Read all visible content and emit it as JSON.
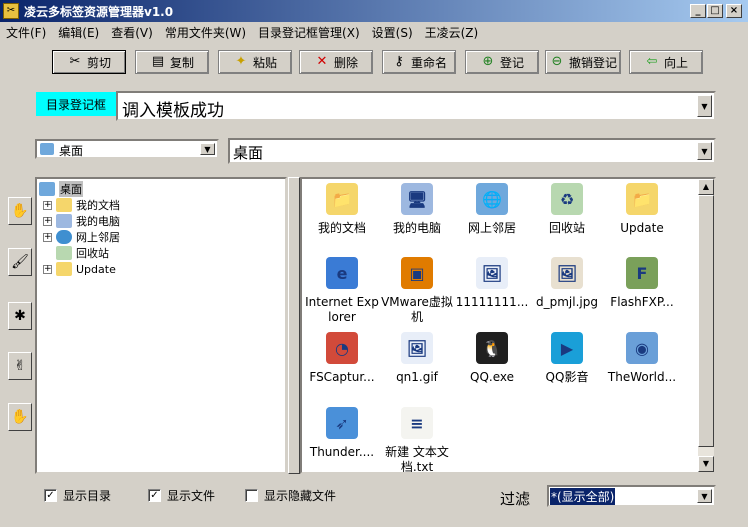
{
  "window": {
    "title": "凌云多标签资源管理器v1.0",
    "min": "_",
    "max": "□",
    "close": "×"
  },
  "menu": [
    "文件(F)",
    "编辑(E)",
    "查看(V)",
    "常用文件夹(W)",
    "目录登记框管理(X)",
    "设置(S)",
    "王凌云(Z)"
  ],
  "toolbar": {
    "cut": "剪切",
    "copy": "复制",
    "paste": "粘贴",
    "delete": "删除",
    "rename": "重命名",
    "register": "登记",
    "unregister": "撤销登记",
    "up": "向上"
  },
  "register_box": {
    "label": "目录登记框",
    "value": "调入模板成功"
  },
  "location": {
    "combo": "桌面",
    "path": "桌面"
  },
  "tree": [
    {
      "label": "桌面",
      "expander": ""
    },
    {
      "label": "我的文档",
      "expander": "+"
    },
    {
      "label": "我的电脑",
      "expander": "+"
    },
    {
      "label": "网上邻居",
      "expander": "+"
    },
    {
      "label": "回收站",
      "expander": ""
    },
    {
      "label": "Update",
      "expander": "+"
    }
  ],
  "files": [
    {
      "label": "我的文档",
      "icon": "folder-docs-icon",
      "color": "#f5d66b",
      "glyph": "📁"
    },
    {
      "label": "我的电脑",
      "icon": "computer-icon",
      "color": "#9db8e0",
      "glyph": "🖥"
    },
    {
      "label": "网上邻居",
      "icon": "network-icon",
      "color": "#6fa8dc",
      "glyph": "🌐"
    },
    {
      "label": "回收站",
      "icon": "recycle-bin-icon",
      "color": "#b8d8b0",
      "glyph": "♻"
    },
    {
      "label": "Update",
      "icon": "folder-icon",
      "color": "#f5d66b",
      "glyph": "📁"
    },
    {
      "label": "Internet Explorer",
      "icon": "ie-icon",
      "color": "#3a7bd5",
      "glyph": "e"
    },
    {
      "label": "VMware虚拟机",
      "icon": "vmware-icon",
      "color": "#e07b00",
      "glyph": "▣"
    },
    {
      "label": "11111111...",
      "icon": "image-file-icon",
      "color": "#e8eef8",
      "glyph": "🖼"
    },
    {
      "label": "d_pmjl.jpg",
      "icon": "jpg-file-icon",
      "color": "#e8e0d0",
      "glyph": "🖼"
    },
    {
      "label": "FlashFXP...",
      "icon": "flashfxp-icon",
      "color": "#7aa05a",
      "glyph": "F"
    },
    {
      "label": "FSCaptur...",
      "icon": "fscapture-icon",
      "color": "#d24a3a",
      "glyph": "◔"
    },
    {
      "label": "qn1.gif",
      "icon": "gif-file-icon",
      "color": "#e8eef8",
      "glyph": "🖼"
    },
    {
      "label": "QQ.exe",
      "icon": "qq-penguin-icon",
      "color": "#202020",
      "glyph": "🐧"
    },
    {
      "label": "QQ影音",
      "icon": "qq-player-icon",
      "color": "#1a9fd8",
      "glyph": "▶"
    },
    {
      "label": "TheWorld...",
      "icon": "theworld-browser-icon",
      "color": "#6a9fd8",
      "glyph": "◉"
    },
    {
      "label": "Thunder....",
      "icon": "thunder-icon",
      "color": "#4a90d9",
      "glyph": "➶"
    },
    {
      "label": "新建 文本文档.txt",
      "icon": "text-file-icon",
      "color": "#f4f4f0",
      "glyph": "≡"
    }
  ],
  "options": {
    "show_dirs": "显示目录",
    "show_files": "显示文件",
    "show_hidden": "显示隐藏文件",
    "check": "✓"
  },
  "filter": {
    "label": "过滤",
    "value": "*(显示全部)"
  }
}
